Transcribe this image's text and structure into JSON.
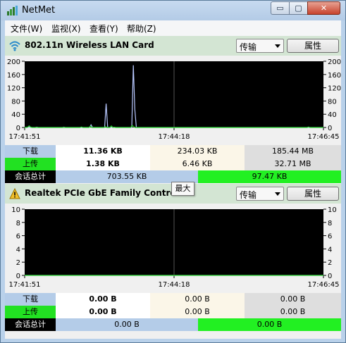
{
  "window": {
    "title": "NetMet",
    "min_glyph": "▭",
    "max_glyph": "▢",
    "close_glyph": "✕"
  },
  "menu": [
    {
      "label": "文件(W)"
    },
    {
      "label": "监视(X)"
    },
    {
      "label": "查看(Y)"
    },
    {
      "label": "帮助(Z)"
    }
  ],
  "adapters": [
    {
      "name": "802.11n Wireless LAN Card",
      "icon": "wifi-icon",
      "mode": "传输",
      "properties_label": "属性",
      "chart_data": {
        "type": "line",
        "y_ticks": [
          "200",
          "160",
          "120",
          "80",
          "40",
          "0"
        ],
        "ylim": [
          0,
          200
        ],
        "x_ticks": [
          "17:41:51",
          "17:44:18",
          "17:46:45"
        ],
        "series": [
          {
            "color": "#b8c8ff",
            "values": [
              0,
              0,
              0,
              2,
              0,
              0,
              0,
              0,
              1,
              0,
              0,
              0,
              0,
              0,
              0,
              0,
              0,
              0,
              0,
              0,
              0,
              0,
              0,
              0,
              0,
              0,
              1,
              0,
              0,
              0,
              0,
              0,
              0,
              0,
              0,
              0,
              0,
              0,
              0,
              0,
              0,
              0,
              0,
              0,
              8,
              0,
              0,
              0,
              0,
              0,
              0,
              0,
              0,
              0,
              72,
              0,
              0,
              0,
              2,
              0,
              0,
              0,
              0,
              0,
              0,
              0,
              0,
              0,
              0,
              0,
              0,
              0,
              188,
              55,
              0,
              0,
              0,
              0,
              0,
              0,
              0,
              0,
              0,
              0,
              0,
              0,
              0,
              0,
              0,
              0,
              0,
              0,
              0,
              0,
              0,
              0,
              0,
              0,
              0,
              0,
              0,
              0,
              0,
              0,
              0,
              0,
              0,
              0,
              0,
              0,
              0,
              0,
              0,
              0,
              0,
              0,
              0,
              0,
              0,
              0,
              0,
              0,
              0,
              0,
              0,
              0,
              0,
              0,
              0,
              0,
              0,
              0,
              0,
              0,
              0,
              0,
              0,
              0,
              0,
              0,
              0,
              0,
              0,
              0,
              0,
              0,
              0,
              0,
              0,
              0,
              0,
              0,
              0,
              0,
              0,
              0,
              0,
              0,
              0,
              0,
              0,
              0,
              0,
              0,
              0,
              0,
              0,
              0,
              0,
              0,
              0,
              0,
              0,
              0,
              0,
              0,
              0,
              0,
              0,
              0,
              0,
              0,
              0,
              0,
              0,
              0,
              0,
              0,
              0,
              0,
              0,
              0,
              0,
              0,
              0,
              0,
              0,
              0,
              0
            ]
          },
          {
            "color": "#22d022",
            "values": [
              0,
              0,
              1,
              5,
              1,
              0,
              0,
              0,
              0,
              0,
              0,
              0,
              0,
              0,
              0,
              0,
              0,
              0,
              0,
              0,
              0,
              0,
              0,
              0,
              0,
              0,
              0,
              0,
              0,
              0,
              0,
              0,
              0,
              0,
              0,
              0,
              0,
              0,
              2,
              0,
              0,
              0,
              0,
              0,
              4,
              0,
              0,
              0,
              0,
              0,
              0,
              0,
              0,
              0,
              3,
              0,
              0,
              0,
              5,
              0,
              1,
              0,
              0,
              0,
              0,
              0,
              0,
              0,
              0,
              0,
              0,
              0,
              6,
              2,
              0,
              0,
              0,
              0,
              0,
              0,
              0,
              0,
              0,
              0,
              0,
              0,
              0,
              0,
              0,
              0,
              0,
              0,
              0,
              0,
              0,
              0,
              0,
              0,
              0,
              0,
              0,
              0,
              0,
              0,
              0,
              0,
              0,
              0,
              0,
              0,
              0,
              0,
              0,
              0,
              0,
              0,
              0,
              0,
              0,
              0,
              0,
              0,
              0,
              0,
              0,
              0,
              0,
              0,
              0,
              0,
              0,
              0,
              0,
              0,
              0,
              0,
              0,
              0,
              0,
              0,
              0,
              0,
              0,
              0,
              0,
              0,
              0,
              0,
              0,
              0,
              0,
              0,
              0,
              0,
              0,
              0,
              0,
              0,
              0,
              0,
              0,
              0,
              0,
              0,
              0,
              0,
              0,
              0,
              0,
              0,
              0,
              0,
              0,
              0,
              0,
              0,
              0,
              0,
              0,
              0,
              0,
              0,
              0,
              0,
              0,
              0,
              0,
              0,
              0,
              0,
              2,
              0,
              0,
              0,
              0,
              0,
              0,
              0,
              0,
              0,
              0
            ]
          }
        ]
      },
      "stats": {
        "download_label": "下载",
        "upload_label": "上传",
        "total_label": "会话总计",
        "download": [
          "11.36 KB",
          "234.03 KB",
          "185.44 MB"
        ],
        "upload": [
          "1.38 KB",
          "6.46 KB",
          "32.71 MB"
        ],
        "total_download": "703.55 KB",
        "total_upload": "97.47 KB"
      }
    },
    {
      "name": "Realtek PCIe GbE Family Controller",
      "icon": "warning-icon",
      "mode": "传输",
      "properties_label": "属性",
      "chart_data": {
        "type": "line",
        "y_ticks": [
          "10",
          "8",
          "6",
          "4",
          "2",
          "0"
        ],
        "ylim": [
          0,
          10
        ],
        "x_ticks": [
          "17:41:51",
          "17:44:18",
          "17:46:45"
        ],
        "series": [
          {
            "color": "#b8c8ff",
            "values": [
              0,
              0
            ]
          },
          {
            "color": "#22d022",
            "values": [
              0,
              0
            ]
          }
        ]
      },
      "stats": {
        "download_label": "下载",
        "upload_label": "上传",
        "total_label": "会话总计",
        "download": [
          "0.00 B",
          "0.00 B",
          "0.00 B"
        ],
        "upload": [
          "0.00 B",
          "0.00 B",
          "0.00 B"
        ],
        "total_download": "0.00 B",
        "total_upload": "0.00 B"
      }
    }
  ],
  "tooltip": "最大"
}
